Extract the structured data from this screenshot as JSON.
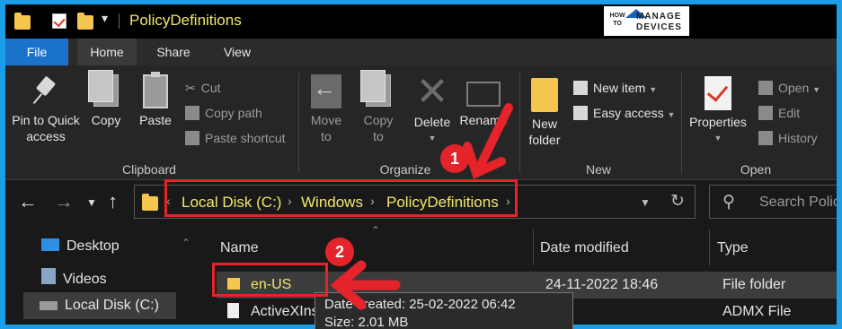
{
  "titlebar": {
    "title": "PolicyDefinitions",
    "qat_menu": "▾"
  },
  "logo": {
    "how_to": "HOW TO",
    "manage": "MANAGE",
    "devices": "DEVICES"
  },
  "tabs": {
    "file": "File",
    "home": "Home",
    "share": "Share",
    "view": "View"
  },
  "ribbon": {
    "clipboard": {
      "pin": "Pin to Quick access",
      "copy": "Copy",
      "paste": "Paste",
      "cut": "Cut",
      "copy_path": "Copy path",
      "paste_shortcut": "Paste shortcut",
      "label": "Clipboard"
    },
    "organize": {
      "move_to": "Move to",
      "copy_to": "Copy to",
      "delete": "Delete",
      "rename": "Rename",
      "label": "Organize"
    },
    "new": {
      "new_folder": "New folder",
      "new_item": "New item",
      "easy_access": "Easy access",
      "label": "New"
    },
    "open": {
      "properties": "Properties",
      "open": "Open",
      "edit": "Edit",
      "history": "History",
      "label": "Open"
    }
  },
  "address": {
    "crumbs": [
      "Local Disk (C:)",
      "Windows",
      "PolicyDefinitions"
    ],
    "overflow": "«",
    "search_placeholder": "Search Polic"
  },
  "navpane": {
    "items": [
      {
        "label": "Desktop",
        "icon": "desktop-icon"
      },
      {
        "label": "Videos",
        "icon": "videos-icon"
      },
      {
        "label": "Local Disk (C:)",
        "icon": "drive-icon",
        "selected": true
      }
    ]
  },
  "files": {
    "columns": [
      "Name",
      "Date modified",
      "Type"
    ],
    "rows": [
      {
        "name": "en-US",
        "date": "24-11-2022 18:46",
        "type": "File folder",
        "selected": true
      },
      {
        "name": "ActiveXInst",
        "date": "",
        "type": "ADMX File"
      }
    ]
  },
  "tooltip": {
    "created": "Date created: 25-02-2022 06:42",
    "size": "Size: 2.01 MB"
  },
  "annotations": {
    "badge1": "1",
    "badge2": "2",
    "color": "#e5232a"
  },
  "colors": {
    "accent": "#1a73c8",
    "folder": "#f4c64d",
    "path_text": "#f3e76a"
  }
}
